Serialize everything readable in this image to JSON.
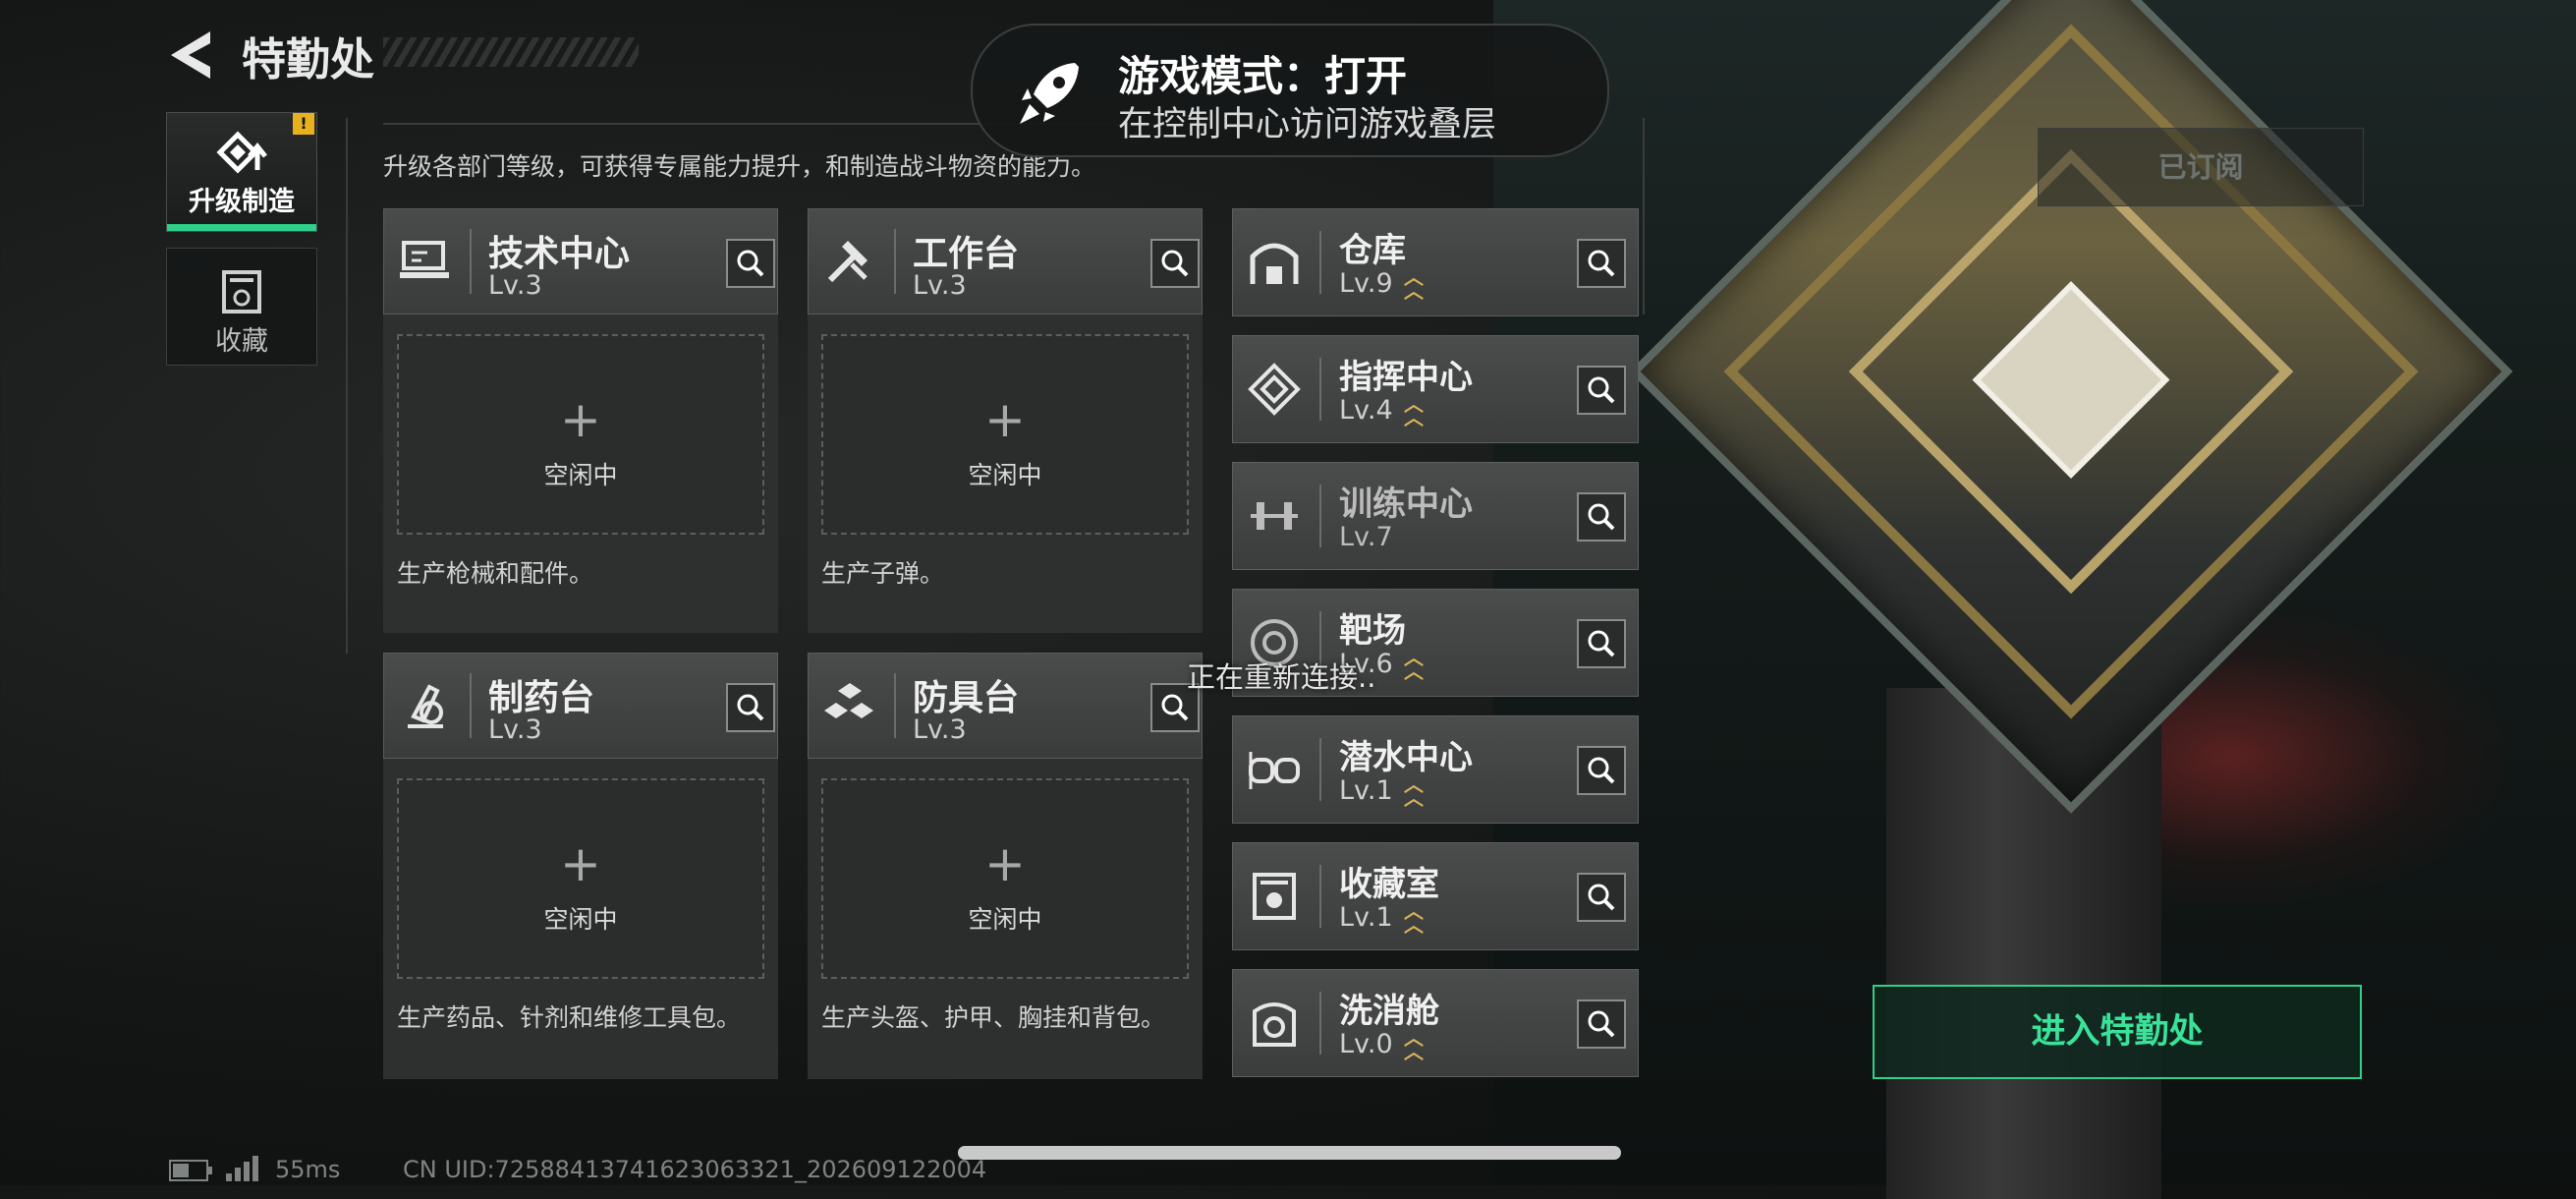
{
  "header": {
    "title": "特勤处",
    "back_icon": "back-arrow-icon"
  },
  "side_tabs": [
    {
      "label": "升级制造",
      "icon": "upgrade-icon",
      "active": true,
      "badge": "!"
    },
    {
      "label": "收藏",
      "icon": "collection-icon",
      "active": false
    }
  ],
  "description": "升级各部门等级，可获得专属能力提升，和制造战斗物资的能力。",
  "facilities": [
    {
      "name": "技术中心",
      "level": "Lv.3",
      "icon": "tech-center-icon",
      "slot_status": "空闲中",
      "product": "生产枪械和配件。"
    },
    {
      "name": "工作台",
      "level": "Lv.3",
      "icon": "workbench-icon",
      "slot_status": "空闲中",
      "product": "生产子弹。"
    },
    {
      "name": "制药台",
      "level": "Lv.3",
      "icon": "pharmacy-icon",
      "slot_status": "空闲中",
      "product": "生产药品、针剂和维修工具包。"
    },
    {
      "name": "防具台",
      "level": "Lv.3",
      "icon": "armor-bench-icon",
      "slot_status": "空闲中",
      "product": "生产头盔、护甲、胸挂和背包。"
    }
  ],
  "departments": [
    {
      "name": "仓库",
      "level": "Lv.9",
      "icon": "warehouse-icon",
      "upgradable": true
    },
    {
      "name": "指挥中心",
      "level": "Lv.4",
      "icon": "command-center-icon",
      "upgradable": true
    },
    {
      "name": "训练中心",
      "level": "Lv.7",
      "icon": "training-center-icon",
      "upgradable": false
    },
    {
      "name": "靶场",
      "level": "Lv.6",
      "icon": "shooting-range-icon",
      "upgradable": true
    },
    {
      "name": "潜水中心",
      "level": "Lv.1",
      "icon": "diving-center-icon",
      "upgradable": true
    },
    {
      "name": "收藏室",
      "level": "Lv.1",
      "icon": "collection-room-icon",
      "upgradable": true
    },
    {
      "name": "洗消舱",
      "level": "Lv.0",
      "icon": "decon-chamber-icon",
      "upgradable": true
    }
  ],
  "toast": {
    "title": "游戏模式：打开",
    "subtitle": "在控制中心访问游戏叠层",
    "icon": "rocket-icon"
  },
  "reconnect_text": "正在重新连接..",
  "subscribe_label": "已订阅",
  "enter_button": "进入特勤处",
  "footer": {
    "ping": "55ms",
    "uid": "CN UID:7258841374162306332​1_202609122004"
  },
  "colors": {
    "accent": "#2fd08a",
    "upgrade_arrow": "#d6b35a",
    "badge": "#e7b21c"
  }
}
